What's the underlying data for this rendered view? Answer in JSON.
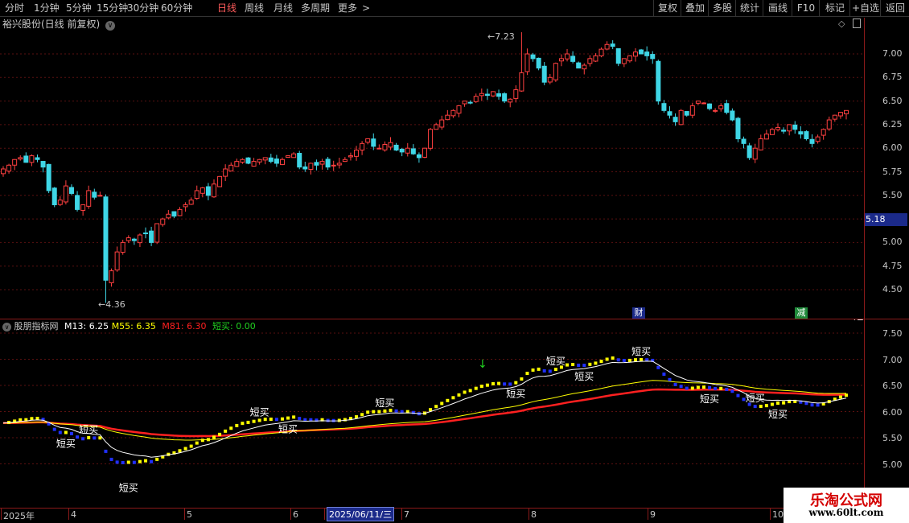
{
  "toolbar": {
    "periods": [
      "分时",
      "1分钟",
      "5分钟",
      "15分钟",
      "30分钟",
      "60分钟",
      "日线",
      "周线",
      "月线",
      "多周期",
      "更多"
    ],
    "active_period": "日线",
    "right_buttons": [
      "复权",
      "叠加",
      "多股",
      "统计",
      "画线",
      "F10",
      "标记",
      "+自选",
      "返回"
    ]
  },
  "main": {
    "title": "裕兴股份(日线 前复权)",
    "current_price_tag": "5.18",
    "high_label": "7.23",
    "low_label": "4.36",
    "y_axis": [
      "7.00",
      "6.75",
      "6.50",
      "6.25",
      "6.00",
      "5.75",
      "5.50",
      "5.25",
      "5.00",
      "4.75",
      "4.50"
    ],
    "events": [
      {
        "label": "财",
        "color": "#1b2a8a"
      },
      {
        "label": "减",
        "color": "#1f8a3a"
      }
    ]
  },
  "indicator": {
    "name": "股朋指标网",
    "m13_label": "M13: 6.25",
    "m55_label": "M55: 6.35",
    "m81_label": "M81: 6.30",
    "buy_label": "短买: 0.00",
    "colors": {
      "m13": "#ffffff",
      "m55": "#ffff00",
      "m81": "#ff2020",
      "buy": "#20d020"
    },
    "y_axis": [
      "7.50",
      "7.00",
      "6.50",
      "6.00",
      "5.50",
      "5.00"
    ],
    "signal_text": "短买"
  },
  "dates": {
    "labels": [
      "2025年",
      "4",
      "5",
      "6",
      "2025/06/11/三",
      "7",
      "8",
      "9",
      "10"
    ]
  },
  "watermark": {
    "title": "乐淘公式网",
    "url": "www.60lt.com"
  },
  "chart_data": {
    "type": "candlestick",
    "title": "裕兴股份(日线 前复权)",
    "price_range": [
      4.36,
      7.23
    ],
    "y_ticks_main": [
      7.0,
      6.75,
      6.5,
      6.25,
      6.0,
      5.75,
      5.5,
      5.25,
      5.0,
      4.75,
      4.5
    ],
    "closes": [
      5.78,
      5.82,
      5.88,
      5.9,
      5.85,
      5.92,
      5.88,
      5.8,
      5.55,
      5.4,
      5.45,
      5.6,
      5.52,
      5.35,
      5.4,
      5.55,
      5.48,
      5.5,
      4.6,
      4.7,
      4.9,
      5.0,
      5.05,
      5.02,
      5.08,
      5.1,
      5.0,
      5.2,
      5.25,
      5.3,
      5.28,
      5.35,
      5.4,
      5.45,
      5.55,
      5.58,
      5.5,
      5.62,
      5.7,
      5.78,
      5.82,
      5.86,
      5.88,
      5.84,
      5.86,
      5.88,
      5.9,
      5.86,
      5.84,
      5.88,
      5.92,
      5.94,
      5.8,
      5.78,
      5.84,
      5.82,
      5.86,
      5.8,
      5.82,
      5.84,
      5.88,
      5.92,
      5.98,
      6.05,
      6.1,
      6.02,
      6.0,
      6.04,
      6.06,
      5.98,
      5.96,
      6.0,
      5.94,
      5.9,
      6.0,
      6.2,
      6.25,
      6.3,
      6.35,
      6.4,
      6.45,
      6.5,
      6.48,
      6.55,
      6.58,
      6.56,
      6.6,
      6.55,
      6.5,
      6.52,
      6.62,
      6.8,
      7.0,
      6.95,
      6.85,
      6.7,
      6.75,
      6.9,
      6.95,
      7.0,
      6.92,
      6.85,
      6.88,
      6.95,
      6.98,
      7.05,
      7.1,
      7.08,
      6.9,
      6.95,
      6.98,
      7.02,
      7.0,
      6.98,
      6.95,
      6.5,
      6.4,
      6.35,
      6.28,
      6.4,
      6.35,
      6.45,
      6.5,
      6.48,
      6.42,
      6.4,
      6.45,
      6.38,
      6.3,
      6.1,
      6.05,
      5.9,
      6.0,
      6.1,
      6.15,
      6.2,
      6.22,
      6.18,
      6.25,
      6.2,
      6.15,
      6.1,
      6.05,
      6.12,
      6.2,
      6.3,
      6.35,
      6.38,
      6.4
    ]
  }
}
